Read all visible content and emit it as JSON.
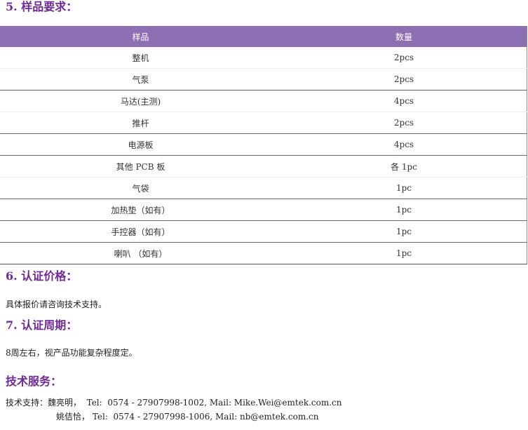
{
  "sections": {
    "samples_title": "5. 样品要求：",
    "price_title": "6. 认证价格：",
    "price_text": "具体报价请咨询技术支持。",
    "period_title": "7. 认证周期：",
    "period_text": "8周左右，视产品功能复杂程度定。",
    "service_title": "技术服务："
  },
  "table": {
    "headers": [
      "样品",
      "数量"
    ],
    "rows": [
      {
        "item": "整机",
        "qty": "2pcs"
      },
      {
        "item": "气泵",
        "qty": "2pcs"
      },
      {
        "item": "马达(主测)",
        "qty": "4pcs"
      },
      {
        "item": "推杆",
        "qty": "2pcs"
      },
      {
        "item": "电源板",
        "qty": "4pcs"
      },
      {
        "item": "其他 PCB 板",
        "qty": "各 1pc"
      },
      {
        "item": "气袋",
        "qty": "1pc"
      },
      {
        "item": "加热垫（如有）",
        "qty": "1pc"
      },
      {
        "item": "手控器（如有）",
        "qty": "1pc"
      },
      {
        "item": "喇叭 （如有）",
        "qty": "1pc"
      }
    ]
  },
  "contacts": [
    {
      "line": "技术支持：魏亮明，  Tel:  0574 - 27907998-1002, Mail: Mike.Wei@emtek.com.cn"
    },
    {
      "line": "姚佶恰， Tel:  0574 - 27907998-1006, Mail: nb@emtek.com.cn"
    }
  ],
  "colors": {
    "heading": "#6f2a94",
    "table_header_bg": "#8d6fb4"
  }
}
